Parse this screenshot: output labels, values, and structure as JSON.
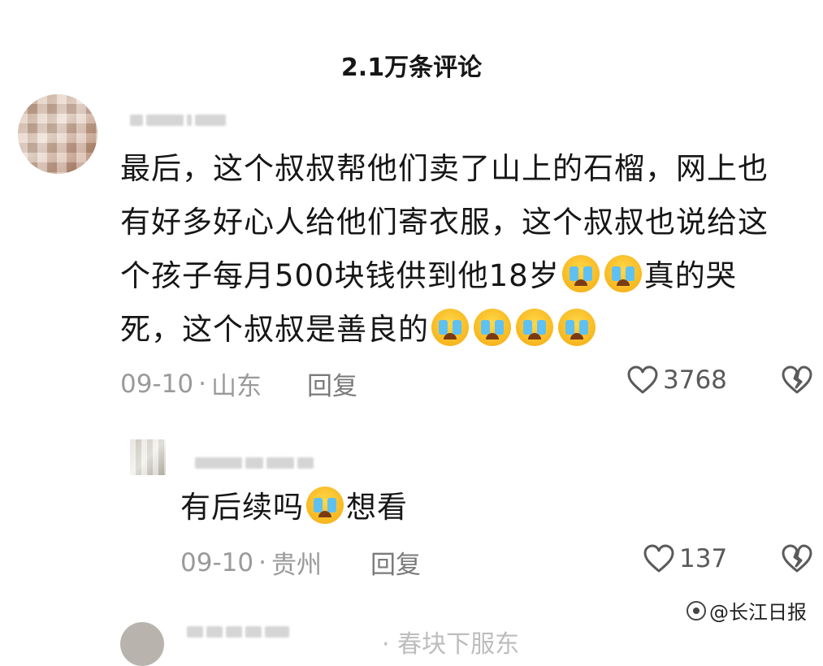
{
  "header": {
    "title": "2.1万条评论"
  },
  "comments": [
    {
      "lines": [
        "最后，这个叔叔帮他们卖了山上的石榴，网上也",
        "有好多好心人给他们寄衣服，这个叔叔也说给这",
        "个孩子每月500块钱供到他18岁",
        "真的哭",
        "死，这个叔叔是善良的"
      ],
      "date": "09-10",
      "separator": "·",
      "location": "山东",
      "reply_label": "回复",
      "likes": "3768"
    },
    {
      "text_before": "有后续吗",
      "text_after": "想看",
      "date": "09-10",
      "separator": "·",
      "location": "贵州",
      "reply_label": "回复",
      "likes": "137"
    }
  ],
  "icons": {
    "emoji": "loudly-crying-face",
    "like": "heart-outline-icon",
    "dislike": "broken-heart-icon"
  },
  "watermark": {
    "text": "@长江日报"
  },
  "partial_next": {
    "text": "· 春块下服东"
  }
}
